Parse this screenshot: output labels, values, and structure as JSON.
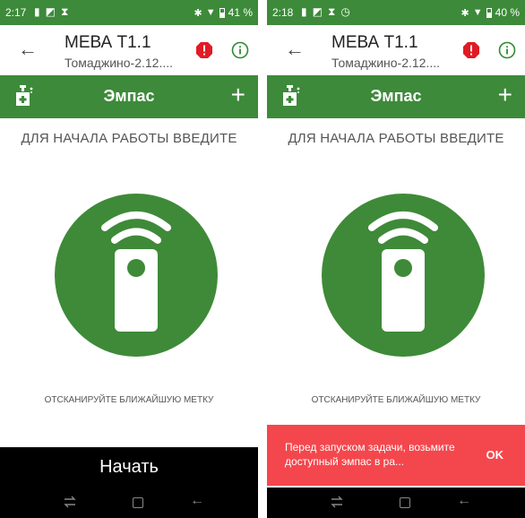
{
  "left_phone": {
    "status": {
      "time": "2:17",
      "battery": "41 %",
      "left_icons": [
        "sim-icon",
        "nfc-icon",
        "hourglass-icon"
      ]
    },
    "appbar": {
      "title": "МЕВА Т1.1",
      "subtitle": "Томаджино-2.12...."
    },
    "toolbar": {
      "title": "Эмпас"
    },
    "prompt": "ДЛЯ НАЧАЛА РАБОТЫ ВВЕДИТЕ",
    "scan_text": "ОТСКАНИРУЙТЕ БЛИЖАЙШУЮ МЕТКУ",
    "start_label": "Начать"
  },
  "right_phone": {
    "status": {
      "time": "2:18",
      "battery": "40 %",
      "left_icons": [
        "sim-icon",
        "nfc-icon",
        "hourglass-icon",
        "phone-icon"
      ]
    },
    "appbar": {
      "title": "МЕВА Т1.1",
      "subtitle": "Томаджино-2.12...."
    },
    "toolbar": {
      "title": "Эмпас"
    },
    "prompt": "ДЛЯ НАЧАЛА РАБОТЫ ВВЕДИТЕ",
    "scan_text": "ОТСКАНИРУЙТЕ БЛИЖАЙШУЮ МЕТКУ",
    "snackbar": {
      "message": "Перед запуском задачи, возьмите доступный эмпас в ра...",
      "action": "OK"
    }
  },
  "colors": {
    "primary": "#3d8a3a",
    "alert": "#e01b24",
    "snackbar": "#f4474d",
    "nav": "#000000"
  }
}
